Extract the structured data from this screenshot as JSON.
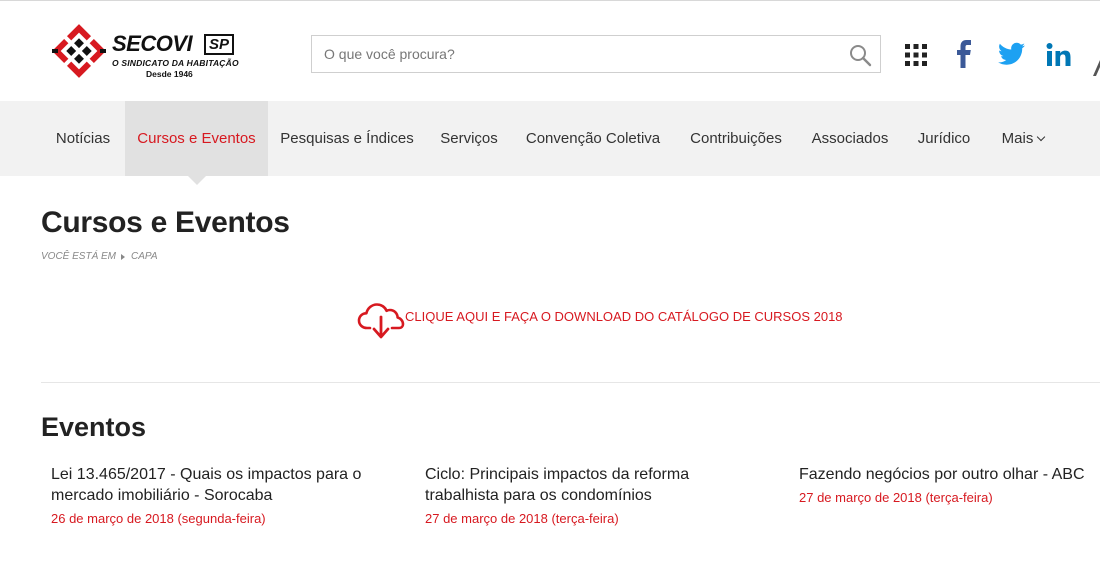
{
  "header": {
    "logo": {
      "name": "SECOVI",
      "region": "SP",
      "subtitle": "O SINDICATO DA HABITAÇÃO",
      "since": "Desde 1946",
      "brand_color": "#d71920"
    },
    "search": {
      "placeholder": "O que você procura?",
      "value": "",
      "icon": "search-icon"
    },
    "social_icons": [
      "apps-grid-icon",
      "facebook-icon",
      "twitter-icon",
      "linkedin-icon"
    ]
  },
  "nav": {
    "items": [
      {
        "label": "Notícias"
      },
      {
        "label": "Cursos e Eventos",
        "active": true
      },
      {
        "label": "Pesquisas e Índices"
      },
      {
        "label": "Serviços"
      },
      {
        "label": "Convenção Coletiva"
      },
      {
        "label": "Contribuições"
      },
      {
        "label": "Associados"
      },
      {
        "label": "Jurídico"
      },
      {
        "label": "Mais",
        "icon": "chevron-down-icon"
      }
    ]
  },
  "main": {
    "title": "Cursos e Eventos",
    "breadcrumb": {
      "prefix": "VOCÊ ESTÁ EM",
      "items": [
        "CAPA"
      ]
    },
    "download": {
      "label": "CLIQUE AQUI E FAÇA O DOWNLOAD DO CATÁLOGO DE CURSOS 2018",
      "icon": "cloud-download-icon"
    },
    "events_section": {
      "title": "Eventos",
      "events": [
        {
          "title": "Lei 13.465/2017 - Quais os impactos para o mercado imobiliário - Sorocaba",
          "date": "26 de março de 2018 (segunda-feira)"
        },
        {
          "title": "Ciclo: Principais impactos da reforma trabalhista para os condomínios",
          "date": "27 de março de 2018 (terça-feira)"
        },
        {
          "title": "Fazendo negócios por outro olhar - ABC",
          "date": "27 de março de 2018 (terça-feira)"
        }
      ]
    }
  },
  "colors": {
    "accent": "#d71920",
    "nav_bg": "#f2f2f2",
    "nav_active_bg": "#e1e1e1",
    "facebook": "#3b5998",
    "twitter": "#1da1f2",
    "linkedin": "#0077b5"
  }
}
